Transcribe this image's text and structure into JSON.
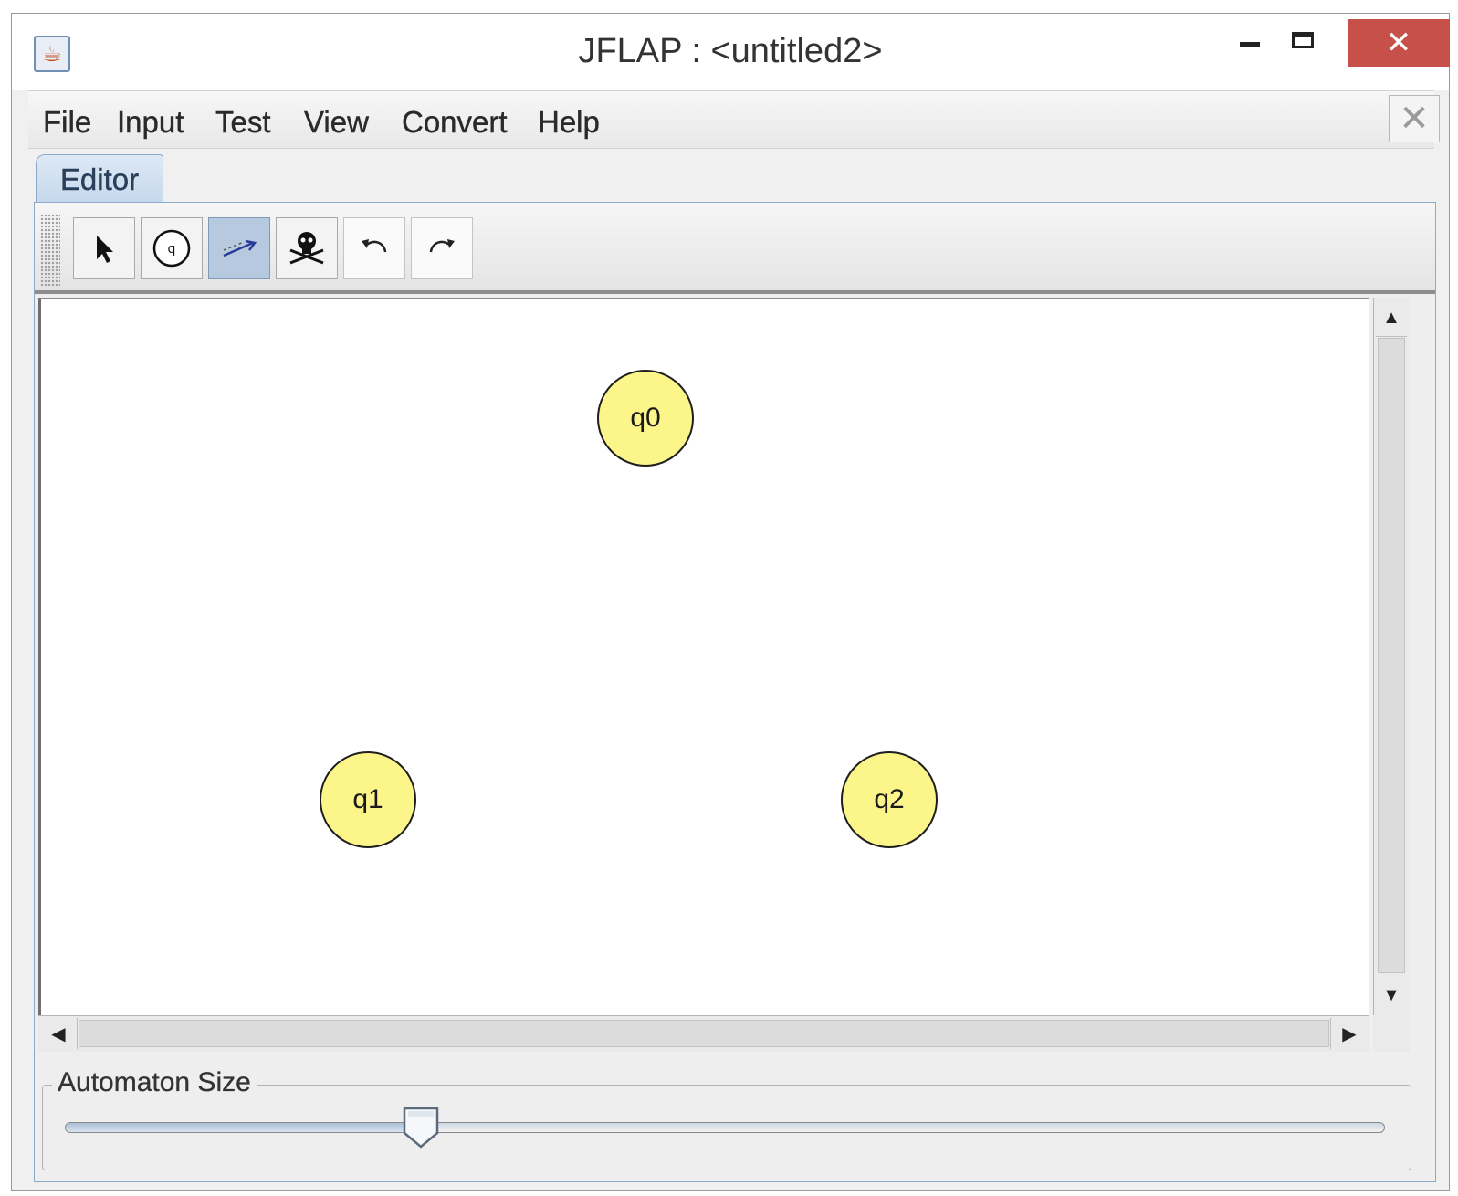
{
  "window": {
    "title": "JFLAP : <untitled2>",
    "controls": {
      "minimize": "minimize",
      "maximize": "maximize",
      "close": "✕"
    }
  },
  "menu": {
    "items": [
      "File",
      "Input",
      "Test",
      "View",
      "Convert",
      "Help"
    ],
    "close_label": "✕"
  },
  "tabs": [
    {
      "label": "Editor",
      "selected": true
    }
  ],
  "toolbar": {
    "tools": [
      {
        "name": "Attribute Editor",
        "icon": "pointer-arrow-icon",
        "active": false
      },
      {
        "name": "State Creator",
        "icon": "state-circle-icon",
        "active": false
      },
      {
        "name": "Transition Creator",
        "icon": "transition-arrow-icon",
        "active": true
      },
      {
        "name": "Deleter",
        "icon": "skull-crossbones-icon",
        "active": false
      },
      {
        "name": "Undo",
        "icon": "undo-icon",
        "active": false
      },
      {
        "name": "Redo",
        "icon": "redo-icon",
        "active": false
      }
    ]
  },
  "canvas": {
    "states": [
      {
        "label": "q0"
      },
      {
        "label": "q1"
      },
      {
        "label": "q2"
      }
    ]
  },
  "automaton_size": {
    "label": "Automaton Size",
    "value_fraction": 0.27
  },
  "colors": {
    "state_fill": "#fbf58a",
    "close_button": "#c7504a",
    "active_tool": "#b6c9df",
    "tab": "#c6d8ec"
  }
}
